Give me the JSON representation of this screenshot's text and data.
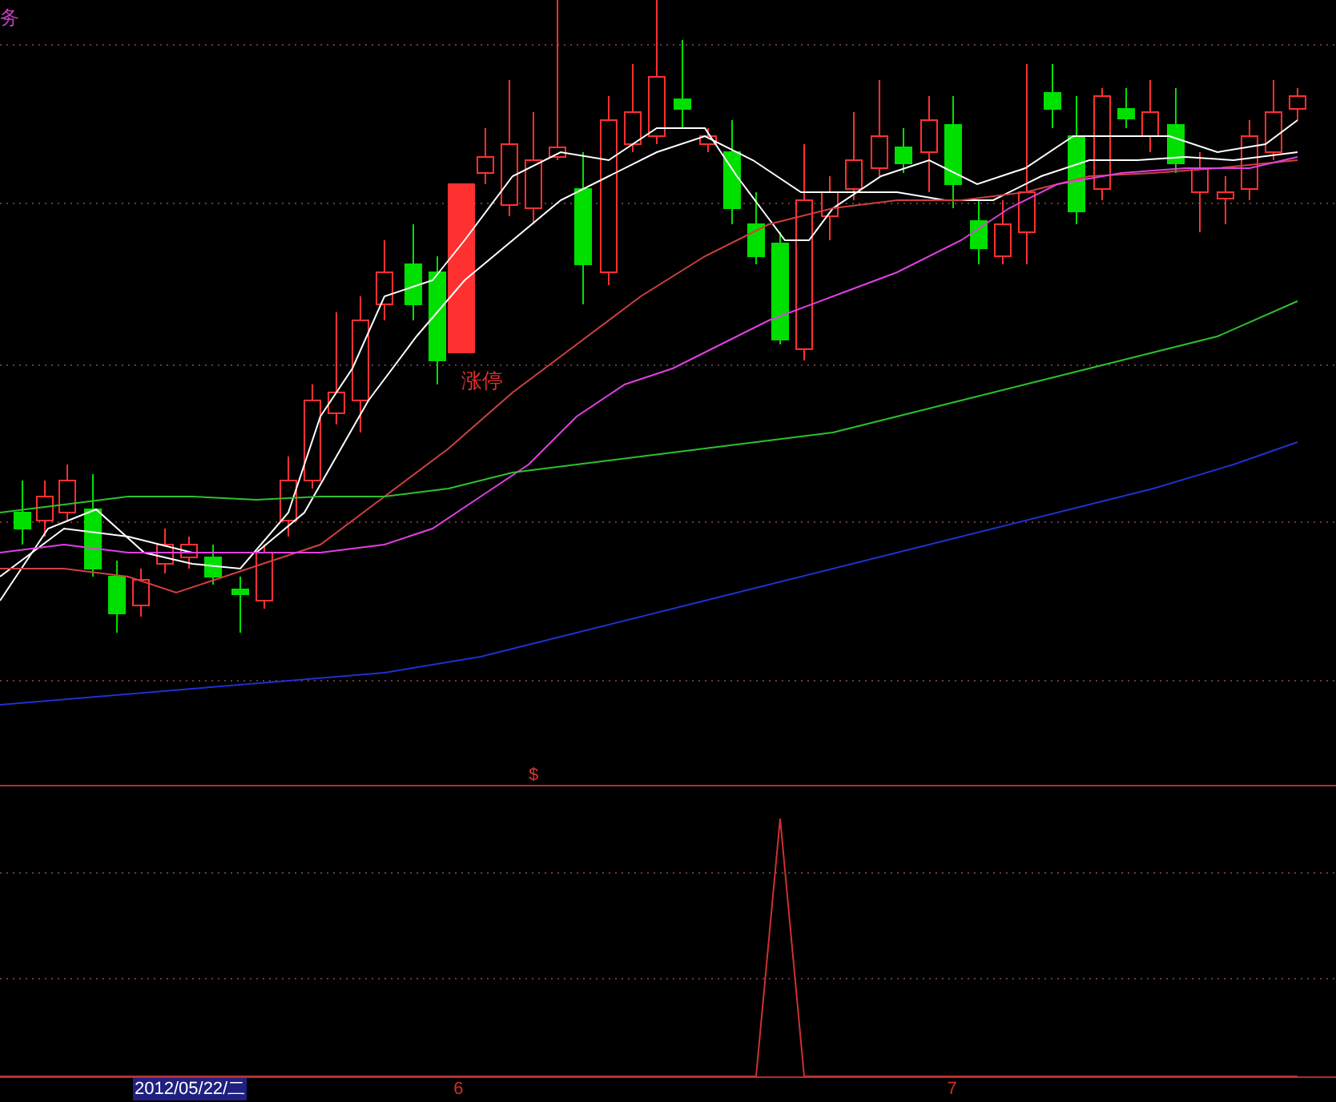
{
  "main_chart": {
    "title": "务",
    "limit_up_label": "涨停"
  },
  "indicator": {
    "label": "$"
  },
  "time_axis": {
    "labels": [
      {
        "text": "2012/05/22/二",
        "selected": true
      },
      {
        "text": "6",
        "selected": false
      },
      {
        "text": "7",
        "selected": false
      }
    ]
  }
}
